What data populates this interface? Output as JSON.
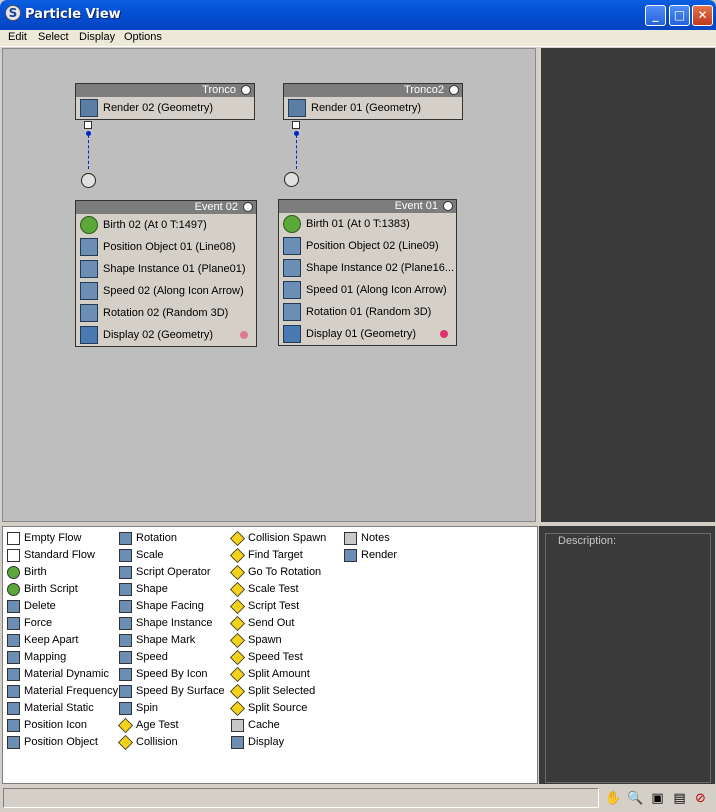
{
  "window": {
    "title": "Particle View",
    "app_icon": "3dsmax-icon"
  },
  "menu": [
    "Edit",
    "Select",
    "Display",
    "Options"
  ],
  "nodes": {
    "tronco": {
      "header": "Tronco",
      "rows": [
        {
          "label": "Render 02 (Geometry)",
          "icon": "render-icon"
        }
      ]
    },
    "tronco2": {
      "header": "Tronco2",
      "rows": [
        {
          "label": "Render 01 (Geometry)",
          "icon": "render-icon"
        }
      ]
    },
    "event02": {
      "header": "Event 02",
      "rows": [
        {
          "label": "Birth 02 (At 0 T:1497)",
          "icon": "birth-icon"
        },
        {
          "label": "Position Object 01 (Line08)",
          "icon": "position-object-icon"
        },
        {
          "label": "Shape Instance 01 (Plane01)",
          "icon": "shape-instance-icon"
        },
        {
          "label": "Speed 02 (Along Icon Arrow)",
          "icon": "speed-icon"
        },
        {
          "label": "Rotation 02 (Random 3D)",
          "icon": "rotation-icon"
        },
        {
          "label": "Display 02 (Geometry)",
          "icon": "display-icon"
        }
      ],
      "display_color": "#e07a8e"
    },
    "event01": {
      "header": "Event 01",
      "rows": [
        {
          "label": "Birth 01 (At 0 T:1383)",
          "icon": "birth-icon"
        },
        {
          "label": "Position Object 02 (Line09)",
          "icon": "position-object-icon"
        },
        {
          "label": "Shape Instance 02 (Plane16...",
          "icon": "shape-instance-icon"
        },
        {
          "label": "Speed 01 (Along Icon Arrow)",
          "icon": "speed-icon"
        },
        {
          "label": "Rotation 01 (Random 3D)",
          "icon": "rotation-icon"
        },
        {
          "label": "Display 01 (Geometry)",
          "icon": "display-icon"
        }
      ],
      "display_color": "#e0306e"
    }
  },
  "depot": {
    "columns": [
      [
        {
          "label": "Empty Flow",
          "kind": "flow"
        },
        {
          "label": "Standard Flow",
          "kind": "flow"
        },
        {
          "label": "Birth",
          "kind": "birth"
        },
        {
          "label": "Birth Script",
          "kind": "birth"
        },
        {
          "label": "Delete",
          "kind": "op"
        },
        {
          "label": "Force",
          "kind": "op"
        },
        {
          "label": "Keep Apart",
          "kind": "op"
        },
        {
          "label": "Mapping",
          "kind": "op"
        },
        {
          "label": "Material Dynamic",
          "kind": "op"
        },
        {
          "label": "Material Frequency",
          "kind": "op"
        },
        {
          "label": "Material Static",
          "kind": "op"
        },
        {
          "label": "Position Icon",
          "kind": "op"
        },
        {
          "label": "Position Object",
          "kind": "op"
        }
      ],
      [
        {
          "label": "Rotation",
          "kind": "op"
        },
        {
          "label": "Scale",
          "kind": "op"
        },
        {
          "label": "Script Operator",
          "kind": "op"
        },
        {
          "label": "Shape",
          "kind": "op"
        },
        {
          "label": "Shape Facing",
          "kind": "op"
        },
        {
          "label": "Shape Instance",
          "kind": "op"
        },
        {
          "label": "Shape Mark",
          "kind": "op"
        },
        {
          "label": "Speed",
          "kind": "op"
        },
        {
          "label": "Speed By Icon",
          "kind": "op"
        },
        {
          "label": "Speed By Surface",
          "kind": "op"
        },
        {
          "label": "Spin",
          "kind": "op"
        },
        {
          "label": "Age Test",
          "kind": "test"
        },
        {
          "label": "Collision",
          "kind": "test"
        }
      ],
      [
        {
          "label": "Collision Spawn",
          "kind": "test"
        },
        {
          "label": "Find Target",
          "kind": "test"
        },
        {
          "label": "Go To Rotation",
          "kind": "test"
        },
        {
          "label": "Scale Test",
          "kind": "test"
        },
        {
          "label": "Script Test",
          "kind": "test"
        },
        {
          "label": "Send Out",
          "kind": "test"
        },
        {
          "label": "Spawn",
          "kind": "test"
        },
        {
          "label": "Speed Test",
          "kind": "test"
        },
        {
          "label": "Split Amount",
          "kind": "test"
        },
        {
          "label": "Split Selected",
          "kind": "test"
        },
        {
          "label": "Split Source",
          "kind": "test"
        },
        {
          "label": "Cache",
          "kind": "misc"
        },
        {
          "label": "Display",
          "kind": "op"
        }
      ],
      [
        {
          "label": "Notes",
          "kind": "misc"
        },
        {
          "label": "Render",
          "kind": "op"
        }
      ]
    ]
  },
  "description": {
    "label": "Description:"
  },
  "status": {
    "text": "",
    "tools": [
      "pan-hand-icon",
      "zoom-icon",
      "zoom-region-icon",
      "zoom-extents-icon",
      "no-zoom-icon"
    ]
  }
}
